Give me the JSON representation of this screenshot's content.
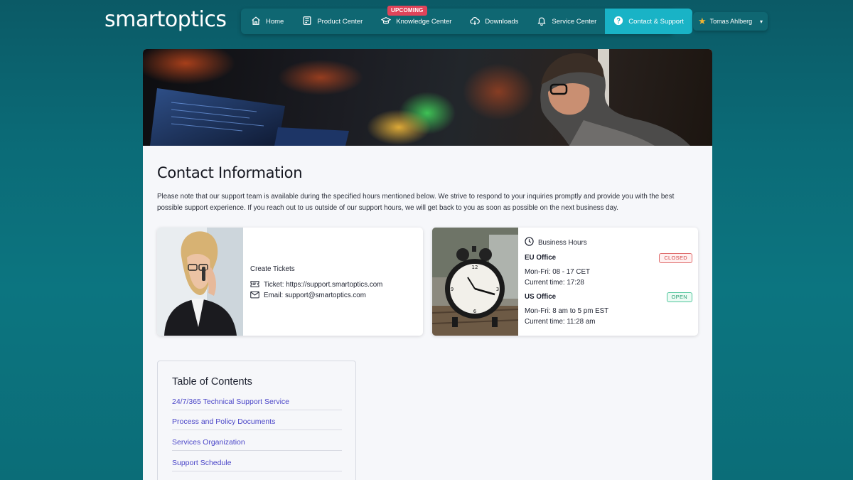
{
  "brand": {
    "logo_text": "smartoptics"
  },
  "nav": {
    "items": [
      {
        "label": "Home",
        "icon": "home-icon"
      },
      {
        "label": "Product Center",
        "icon": "document-icon"
      },
      {
        "label": "Knowledge Center",
        "icon": "graduation-cap-icon"
      },
      {
        "label": "Downloads",
        "icon": "cloud-download-icon"
      },
      {
        "label": "Service Center",
        "icon": "bell-icon"
      },
      {
        "label": "Contact & Support",
        "icon": "question-circle-icon",
        "active": true
      }
    ],
    "upcoming_badge": "UPCOMING"
  },
  "user": {
    "name": "Tomas Ahlberg",
    "icon": "star-icon"
  },
  "page": {
    "title": "Contact Information",
    "intro": "Please note that our support team is available during the specified hours mentioned below. We strive to respond to your inquiries promptly and provide you with the best possible support experience. If you reach out to us outside of our support hours, we will get back to you as soon as possible on the next business day."
  },
  "tickets": {
    "heading": "Create Tickets",
    "ticket_line": "Ticket: https://support.smartoptics.com",
    "email_line": "Email: support@smartoptics.com"
  },
  "business_hours": {
    "heading": "Business Hours",
    "offices": [
      {
        "name": "EU Office",
        "hours": "Mon-Fri: 08 - 17 CET",
        "current": "Current time: 17:28",
        "status": "CLOSED"
      },
      {
        "name": "US Office",
        "hours": "Mon-Fri: 8 am to 5 pm EST",
        "current": "Current time: 11:28 am",
        "status": "OPEN"
      }
    ]
  },
  "toc": {
    "title": "Table of Contents",
    "items": [
      "24/7/365 Technical Support Service",
      "Process and Policy Documents",
      "Services Organization",
      "Support Schedule"
    ]
  },
  "colors": {
    "background": "#0b6b77",
    "nav_active": "#19b3c6",
    "link": "#4b46c8",
    "closed": "#d04545",
    "open": "#289f73",
    "badge": "#e0445a"
  }
}
